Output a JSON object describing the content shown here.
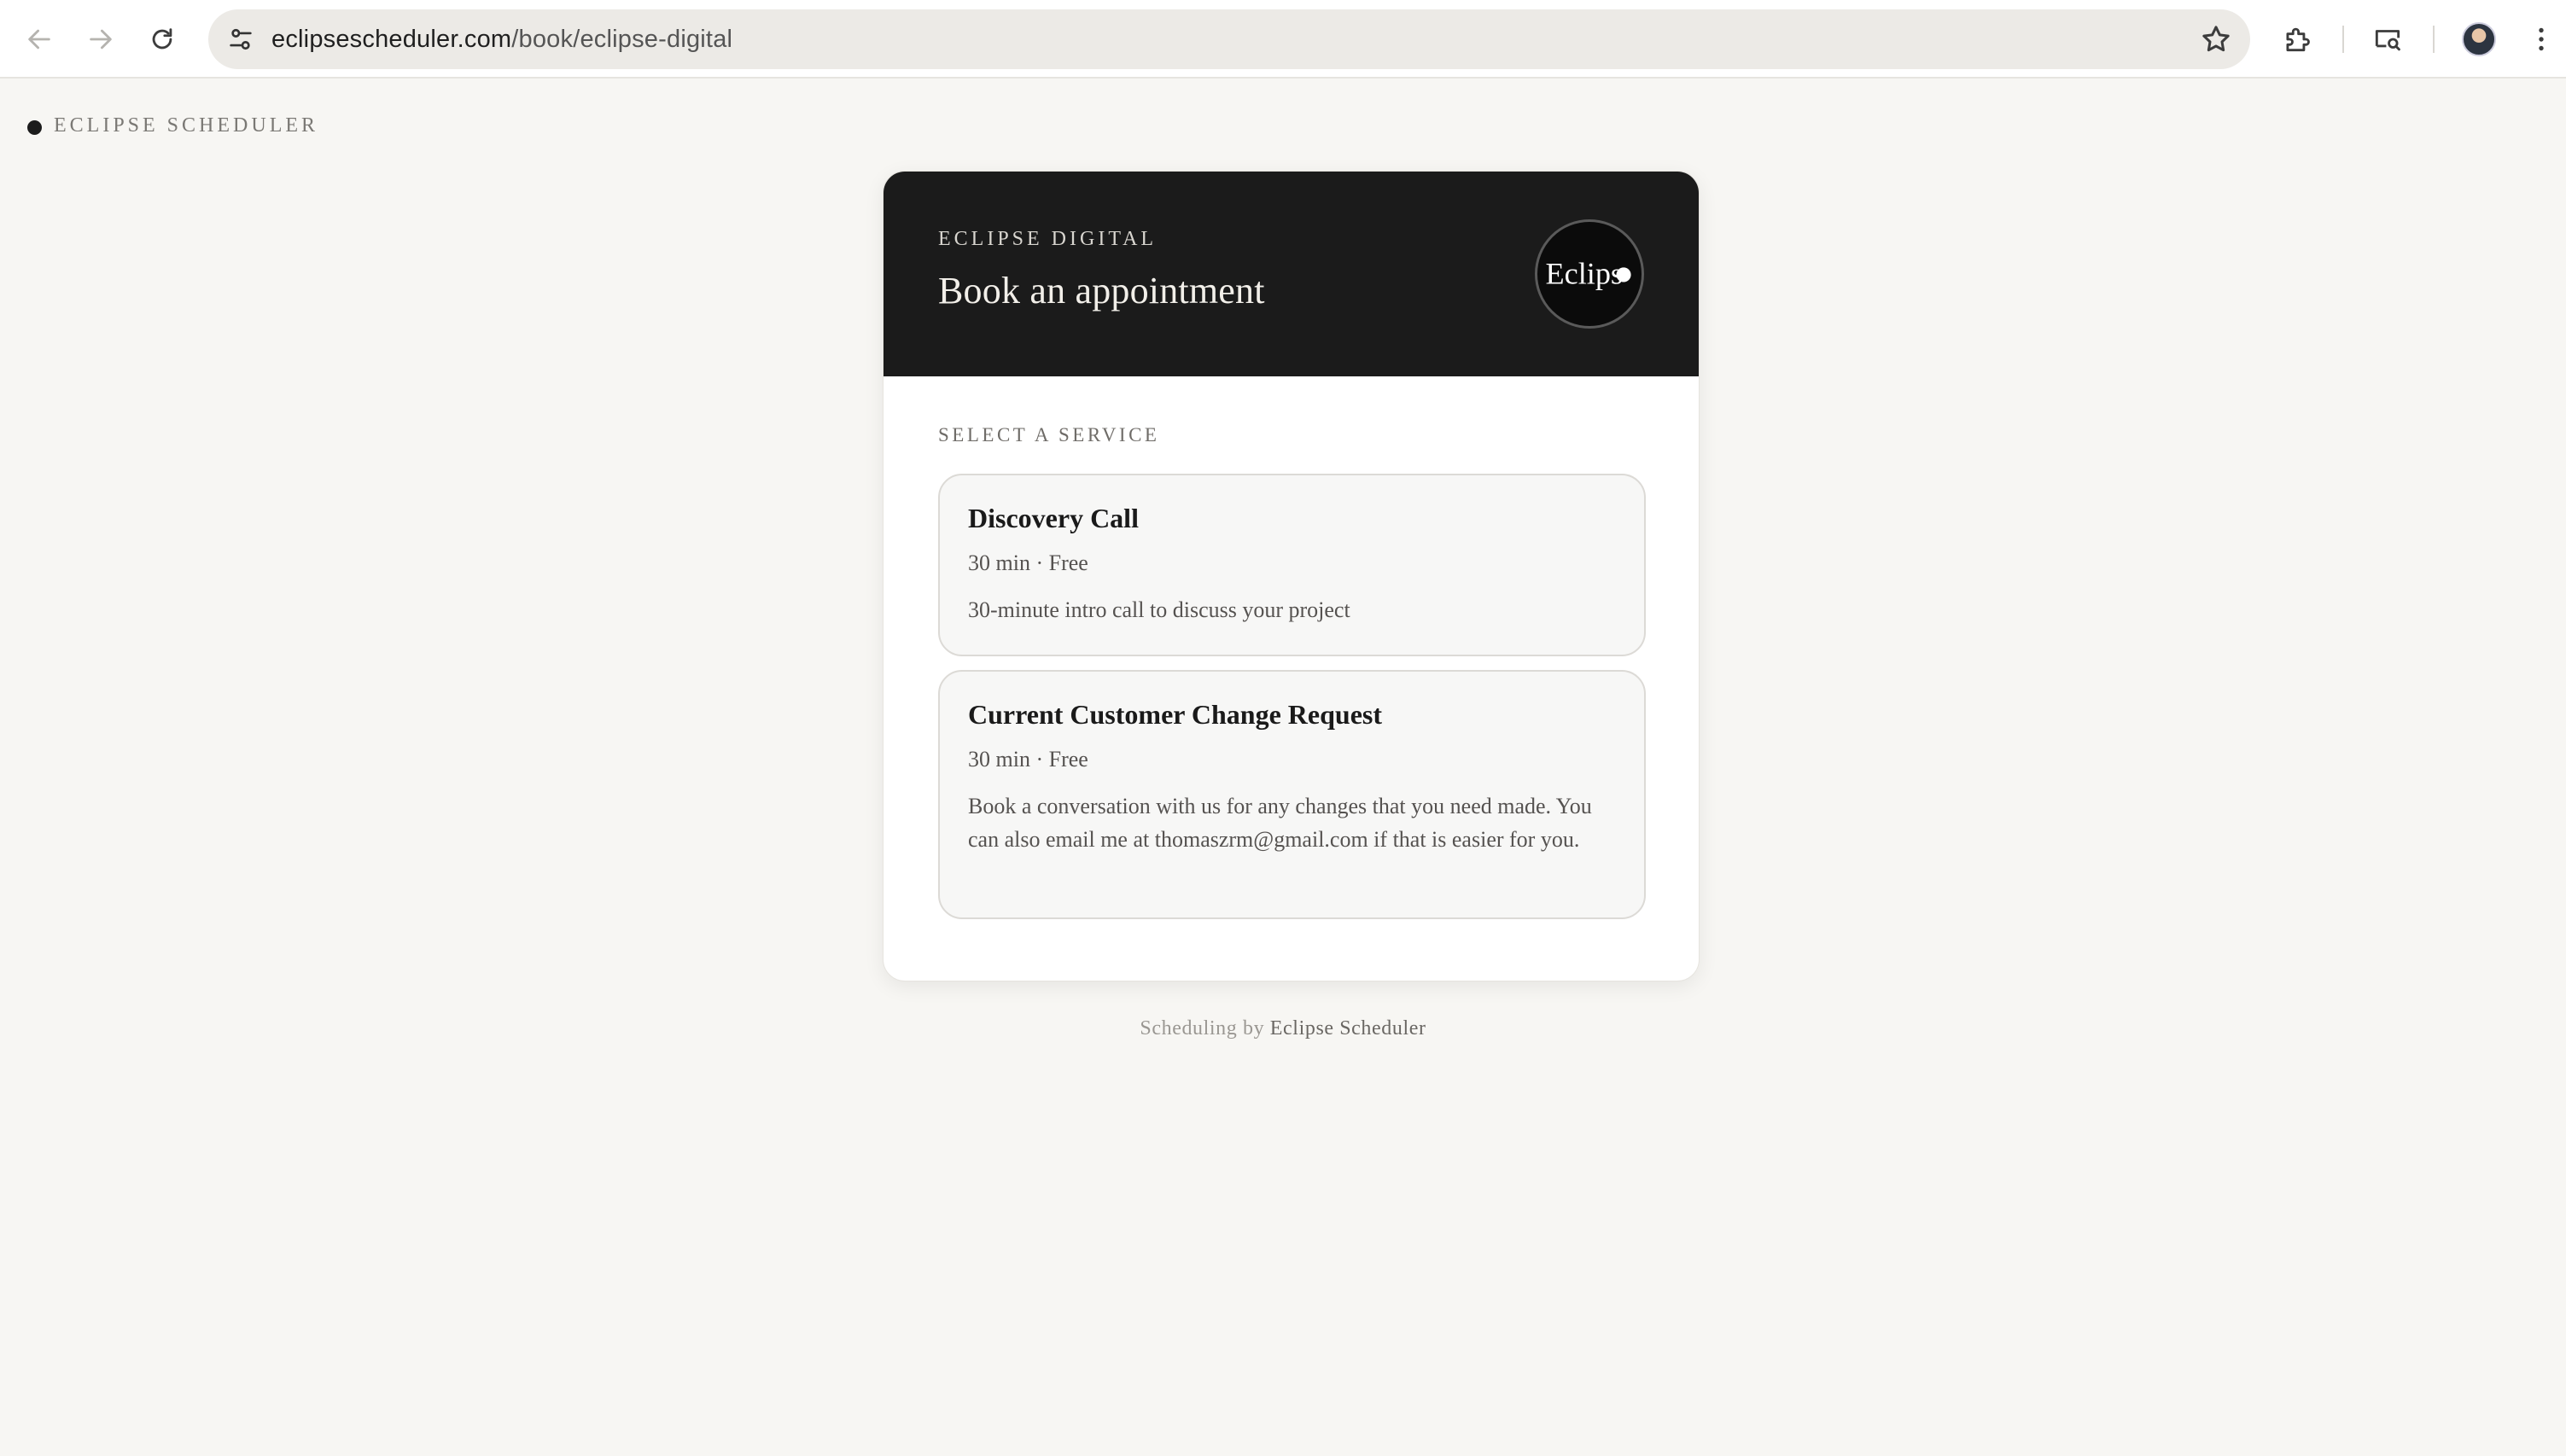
{
  "browser": {
    "url_host": "eclipsescheduler.com",
    "url_path": "/book/eclipse-digital"
  },
  "page": {
    "brand_name": "ECLIPSE SCHEDULER",
    "card": {
      "org_name": "ECLIPSE DIGITAL",
      "title": "Book an appointment",
      "logo_text": "Eclips",
      "section_label": "SELECT A SERVICE",
      "services": [
        {
          "title": "Discovery Call",
          "meta": "30 min · Free",
          "description": "30-minute intro call to discuss your project"
        },
        {
          "title": "Current Customer Change Request",
          "meta": "30 min · Free",
          "description": "Book a conversation with us for any changes that you need made. You can also email me at thomaszrm@gmail.com if that is easier for you."
        }
      ]
    },
    "footer": {
      "prefix": "Scheduling by",
      "link": "Eclipse Scheduler"
    }
  },
  "icons": {
    "back": "arrow-left-icon",
    "forward": "arrow-right-icon",
    "reload": "reload-icon",
    "site_info": "tune-icon",
    "bookmark": "star-icon",
    "extensions": "puzzle-icon",
    "cast": "cast-search-icon",
    "profile": "avatar",
    "menu": "kebab-menu-icon"
  }
}
